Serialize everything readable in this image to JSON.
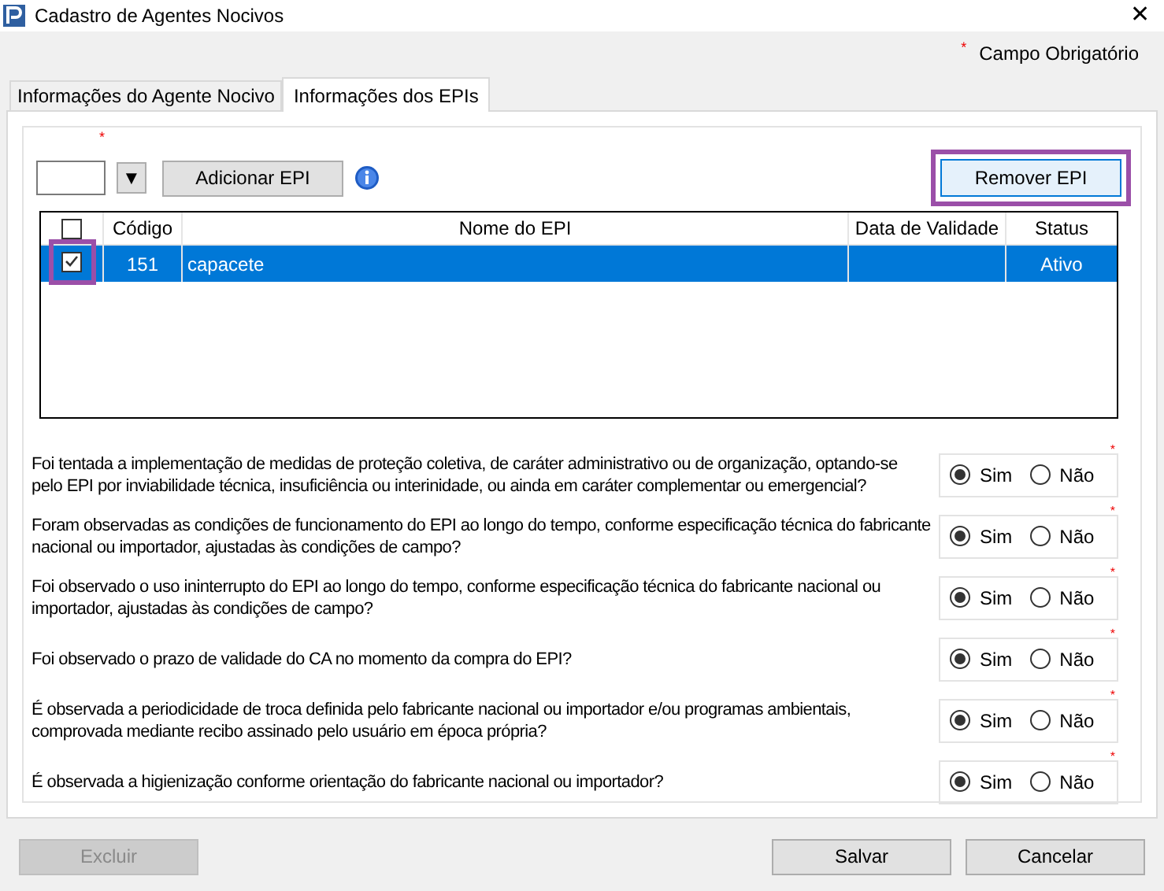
{
  "window": {
    "title": "Cadastro de Agentes Nocivos",
    "close": "✕"
  },
  "required_note": {
    "mark": "*",
    "label": "Campo Obrigatório"
  },
  "tabs": [
    {
      "label": "Informações do Agente Nocivo",
      "selected": false
    },
    {
      "label": "Informações dos EPIs",
      "selected": true
    }
  ],
  "toolbar": {
    "required_mark": "*",
    "dropdown": "▼",
    "add_button": "Adicionar EPI",
    "remove_button": {
      "label": "Remover EPI",
      "highlighted": true
    }
  },
  "table": {
    "columns": [
      "Código",
      "Nome do EPI",
      "Data de Validade",
      "Status"
    ],
    "all_checked": false,
    "rows": [
      {
        "checked": true,
        "highlighted": true,
        "selected": true,
        "cells": [
          "151",
          "capacete",
          "",
          "Ativo"
        ]
      }
    ]
  },
  "questions": [
    {
      "text": "Foi tentada a implementação de medidas de proteção coletiva, de caráter administrativo ou de organização, optando-se pelo EPI por inviabilidade técnica, insuficiência ou interinidade, ou ainda em caráter complementar ou emergencial?",
      "required": true,
      "options": [
        {
          "label": "Sim",
          "selected": true
        },
        {
          "label": "Não",
          "selected": false
        }
      ]
    },
    {
      "text": "Foram observadas as condições de funcionamento do EPI ao longo do tempo, conforme especificação técnica do fabricante nacional ou importador, ajustadas às condições de campo?",
      "required": true,
      "options": [
        {
          "label": "Sim",
          "selected": true
        },
        {
          "label": "Não",
          "selected": false
        }
      ]
    },
    {
      "text": "Foi observado o uso ininterrupto do EPI ao longo do tempo, conforme especificação técnica do fabricante nacional ou importador, ajustadas às condições de campo?",
      "required": true,
      "options": [
        {
          "label": "Sim",
          "selected": true
        },
        {
          "label": "Não",
          "selected": false
        }
      ]
    },
    {
      "text": "Foi observado o prazo de validade do CA no momento da compra do EPI?",
      "required": true,
      "options": [
        {
          "label": "Sim",
          "selected": true
        },
        {
          "label": "Não",
          "selected": false
        }
      ]
    },
    {
      "text": "É observada a periodicidade de troca definida pelo fabricante nacional ou importador e/ou programas ambientais, comprovada mediante recibo assinado pelo usuário em época própria?",
      "required": true,
      "options": [
        {
          "label": "Sim",
          "selected": true
        },
        {
          "label": "Não",
          "selected": false
        }
      ]
    },
    {
      "text": "É observada a higienização conforme orientação do fabricante nacional ou importador?",
      "required": true,
      "options": [
        {
          "label": "Sim",
          "selected": true
        },
        {
          "label": "Não",
          "selected": false
        }
      ]
    }
  ],
  "buttons": [
    {
      "label": "Excluir",
      "disabled": true
    },
    {
      "label": "Salvar",
      "disabled": false
    },
    {
      "label": "Cancelar",
      "disabled": false
    }
  ]
}
